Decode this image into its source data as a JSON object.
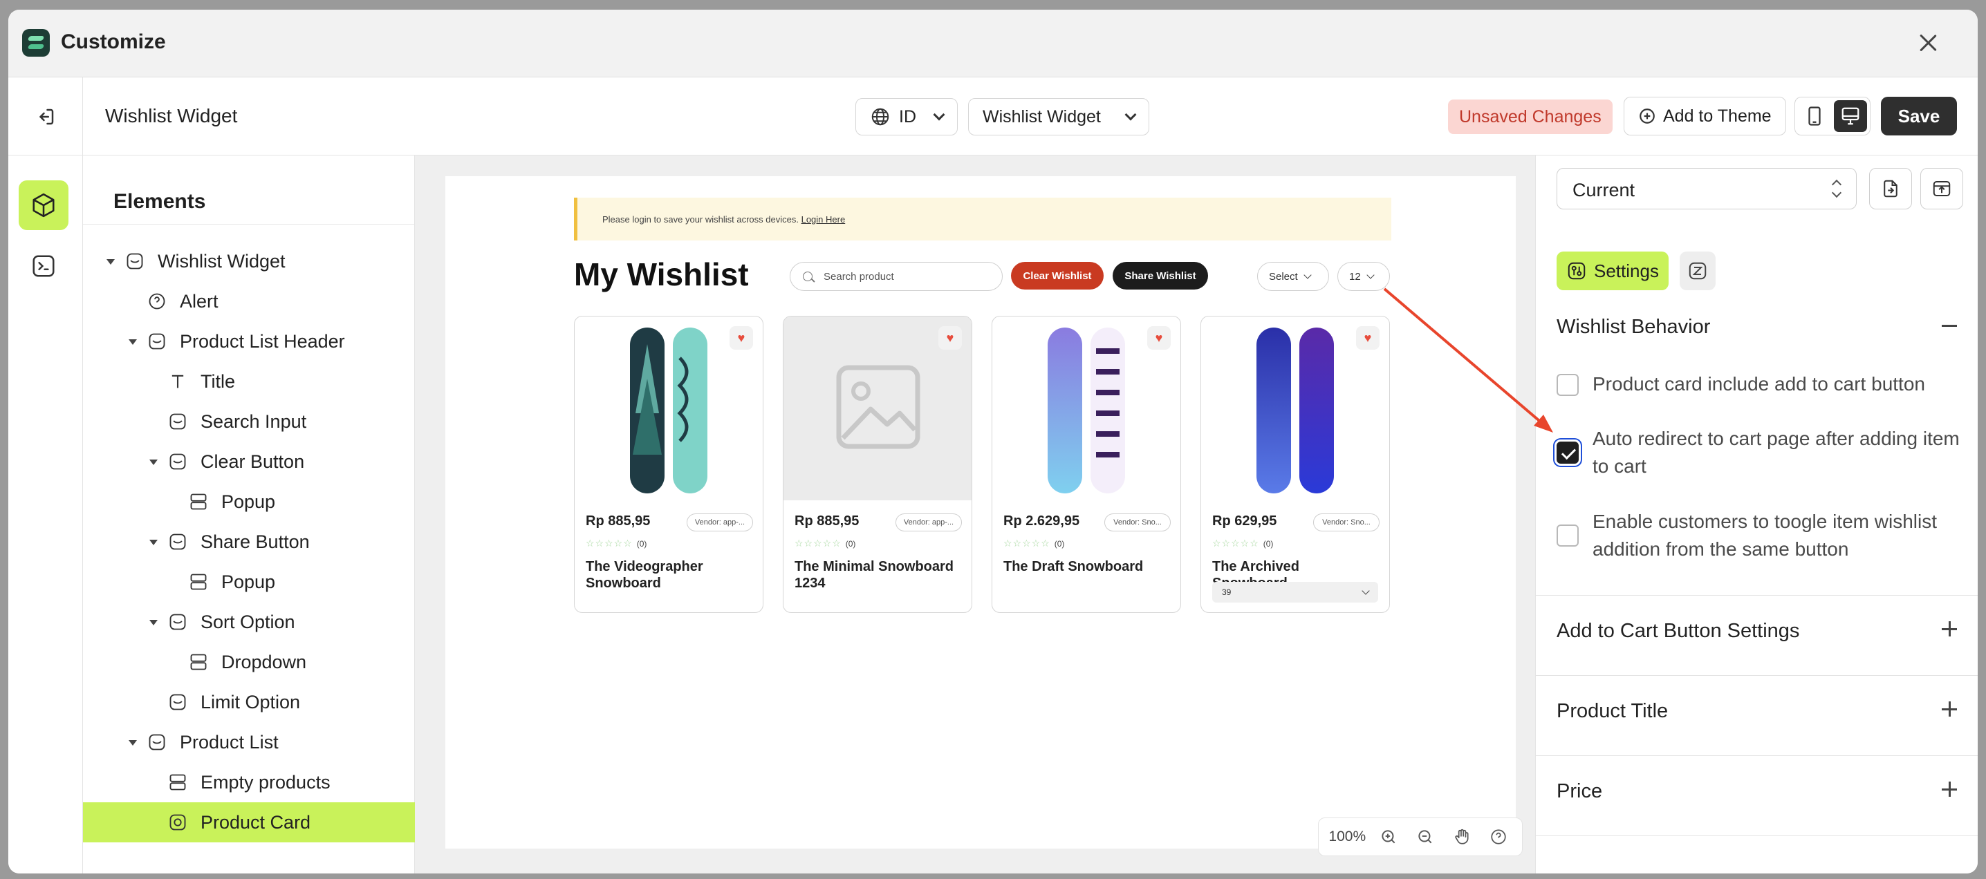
{
  "window": {
    "title": "Customize"
  },
  "toolbar": {
    "page_title": "Wishlist Widget",
    "language": "ID",
    "widget_select": "Wishlist Widget",
    "unsaved": "Unsaved Changes",
    "add_to_theme": "Add to Theme",
    "save": "Save"
  },
  "elements": {
    "heading": "Elements",
    "tree": [
      {
        "label": "Wishlist Widget"
      },
      {
        "label": "Alert"
      },
      {
        "label": "Product List Header"
      },
      {
        "label": "Title"
      },
      {
        "label": "Search Input"
      },
      {
        "label": "Clear Button"
      },
      {
        "label": "Popup"
      },
      {
        "label": "Share Button"
      },
      {
        "label": "Popup"
      },
      {
        "label": "Sort Option"
      },
      {
        "label": "Dropdown"
      },
      {
        "label": "Limit Option"
      },
      {
        "label": "Product List"
      },
      {
        "label": "Empty products"
      },
      {
        "label": "Product Card"
      }
    ]
  },
  "preview": {
    "alert_text": "Please login to save your wishlist across devices.",
    "alert_link": "Login Here",
    "title": "My Wishlist",
    "search_placeholder": "Search product",
    "clear_label": "Clear Wishlist",
    "share_label": "Share Wishlist",
    "sort_label": "Select",
    "limit_label": "12",
    "products": [
      {
        "price": "Rp 885,95",
        "vendor": "Vendor: app-...",
        "stars": "☆☆☆☆☆",
        "reviews": "(0)",
        "name": "The Videographer Snowboard"
      },
      {
        "price": "Rp 885,95",
        "vendor": "Vendor: app-...",
        "stars": "☆☆☆☆☆",
        "reviews": "(0)",
        "name": "The Minimal Snowboard 1234"
      },
      {
        "price": "Rp 2.629,95",
        "vendor": "Vendor: Sno...",
        "stars": "☆☆☆☆☆",
        "reviews": "(0)",
        "name": "The Draft Snowboard"
      },
      {
        "price": "Rp 629,95",
        "vendor": "Vendor: Sno...",
        "stars": "☆☆☆☆☆",
        "reviews": "(0)",
        "name": "The Archived Snowboard",
        "variant": "39"
      }
    ],
    "zoom": "100%"
  },
  "settings": {
    "preset": "Current",
    "tab_label": "Settings",
    "section_title": "Wishlist Behavior",
    "options": [
      {
        "label": "Product card include add to cart button",
        "checked": false
      },
      {
        "label": "Auto redirect to cart page after adding item to cart",
        "checked": true
      },
      {
        "label": "Enable customers to toogle item wishlist addition from the same button",
        "checked": false
      }
    ],
    "collapsed_sections": [
      {
        "title": "Add to Cart Button Settings"
      },
      {
        "title": "Product Title"
      },
      {
        "title": "Price"
      }
    ]
  },
  "colors": {
    "accent_lime": "#c9f25a",
    "danger": "#c93a21",
    "annotation_arrow": "#e8452c"
  }
}
